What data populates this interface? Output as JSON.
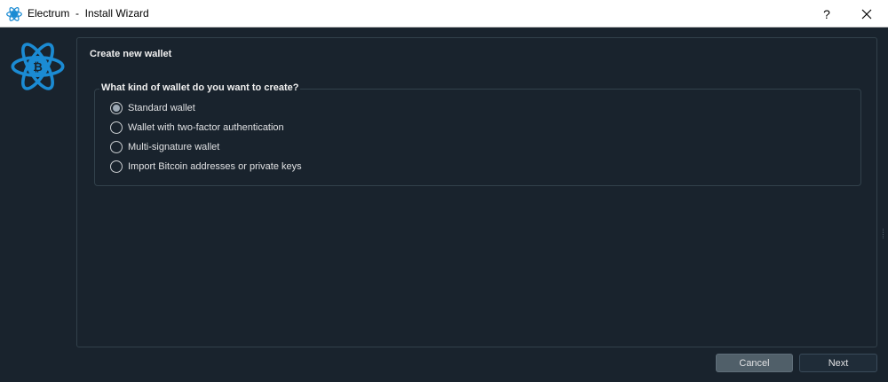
{
  "window": {
    "title": "Electrum  -  Install Wizard",
    "help_label": "?",
    "close_icon": "close-icon"
  },
  "colors": {
    "background": "#19232d",
    "accent": "#1b8bd3",
    "frame_border": "#32414b"
  },
  "page": {
    "title": "Create new wallet"
  },
  "wallet_type": {
    "question": "What kind of wallet do you want to create?",
    "selected": "Standard wallet",
    "options": [
      {
        "label": "Standard wallet",
        "checked": true
      },
      {
        "label": "Wallet with two-factor authentication",
        "checked": false
      },
      {
        "label": "Multi-signature wallet",
        "checked": false
      },
      {
        "label": "Import Bitcoin addresses or private keys",
        "checked": false
      }
    ]
  },
  "buttons": {
    "cancel_label": "Cancel",
    "next_label": "Next"
  }
}
